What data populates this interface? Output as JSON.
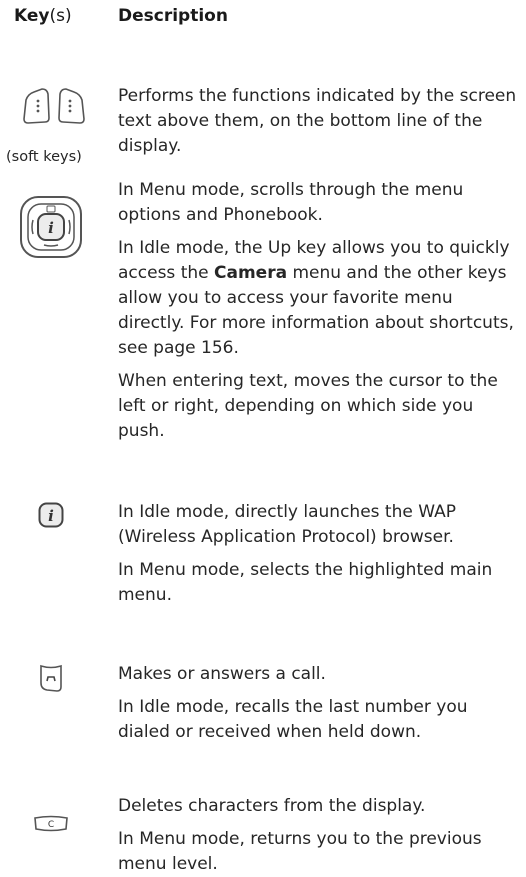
{
  "header": {
    "key_bold": "Key",
    "key_suffix": "(s)",
    "description": "Description"
  },
  "rows": [
    {
      "icon": "soft-keys-icon",
      "caption": "(soft keys)",
      "paragraphs": [
        "Performs the functions indicated by the screen text above them, on the bottom line of the display."
      ]
    },
    {
      "icon": "navigation-keys-icon",
      "paragraphs": [
        "In Menu mode, scrolls through the menu options and Phonebook.",
        {
          "before": "In Idle mode, the Up key allows you to quickly access the ",
          "bold": "Camera",
          "after": " menu and the other keys allow you to access your favorite menu directly. For more information about shortcuts, see page 156."
        },
        "When entering text, moves the cursor to the left or right, depending on which side you push."
      ]
    },
    {
      "icon": "wap-key-icon",
      "paragraphs": [
        "In Idle mode, directly launches the WAP (Wireless Application Protocol) browser.",
        "In Menu mode, selects the highlighted main menu."
      ]
    },
    {
      "icon": "send-key-icon",
      "paragraphs": [
        "Makes or answers a call.",
        "In Idle mode, recalls the last number you dialed or received when held down."
      ]
    },
    {
      "icon": "clear-key-icon",
      "paragraphs": [
        "Deletes characters from the display.",
        "In Menu mode, returns you to the previous menu level."
      ]
    }
  ],
  "icon_glyphs": {
    "wap": "i",
    "nav_center": "i",
    "clear": "C"
  },
  "colors": {
    "text": "#262626",
    "icon_stroke": "#555555"
  }
}
